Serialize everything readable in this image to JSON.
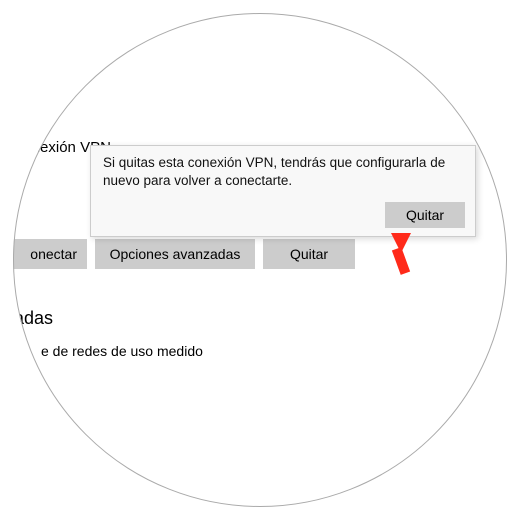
{
  "heading_partial": "na conexión VPN",
  "buttons": {
    "connect": "onectar",
    "advanced": "Opciones avanzadas",
    "remove": "Quitar"
  },
  "section_partial": "nzadas",
  "subtext_partial": "e de redes de uso medido",
  "dialog": {
    "message": "Si quitas esta conexión VPN, tendrás que configurarla de nuevo para volver a conectarte.",
    "confirm": "Quitar"
  },
  "arrow_color": "#ff2a1a"
}
